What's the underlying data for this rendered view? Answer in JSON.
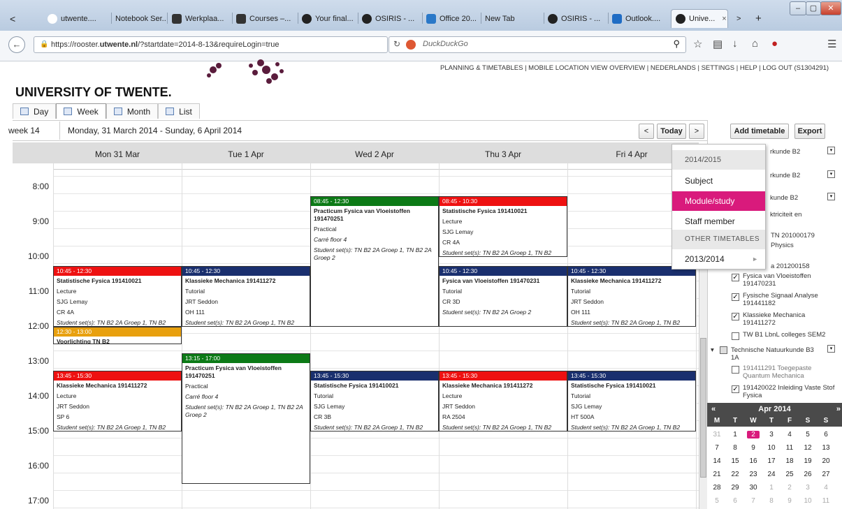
{
  "browser": {
    "tabs": [
      {
        "label": "",
        "icon": "back-arrow-icon"
      },
      {
        "label": "utwente....",
        "icon": "ut-icon",
        "color": "#ffffff"
      },
      {
        "label": "Notebook Ser...",
        "icon": "",
        "color": ""
      },
      {
        "label": "Werkplaa...",
        "icon": "blackboard-icon",
        "color": "#333333"
      },
      {
        "label": "Courses –...",
        "icon": "blackboard-icon",
        "color": "#333333"
      },
      {
        "label": "Your final...",
        "icon": "ut-icon",
        "color": "#222222"
      },
      {
        "label": "OSIRIS - ...",
        "icon": "ut-icon",
        "color": "#222222"
      },
      {
        "label": "Office 20...",
        "icon": "office-icon",
        "color": "#2a78c8"
      },
      {
        "label": "New Tab",
        "icon": "",
        "color": ""
      },
      {
        "label": "OSIRIS - ...",
        "icon": "ut-icon",
        "color": "#222222"
      },
      {
        "label": "Outlook....",
        "icon": "outlook-icon",
        "color": "#1f6cc4"
      },
      {
        "label": "Unive...",
        "icon": "ut-icon",
        "color": "#222222"
      }
    ],
    "url_prefix": "https://rooster.",
    "url_domain": "utwente.nl",
    "url_suffix": "/?startdate=2014-8-13&requireLogin=true",
    "search_placeholder": "DuckDuckGo",
    "tab_close": "×",
    "tab_add": "+"
  },
  "site": {
    "top_links": "PLANNING & TIMETABLES | MOBILE   LOCATION VIEW   OVERVIEW | NEDERLANDS | SETTINGS | HELP | LOG OUT (S1304291)",
    "university": "UNIVERSITY OF TWENTE.",
    "view_tabs": [
      "Day",
      "Week",
      "Month",
      "List"
    ]
  },
  "toolbar": {
    "week_label": "week 14",
    "date_range": "Monday, 31 March 2014 - Sunday, 6 April 2014",
    "prev": "<",
    "today": "Today",
    "next": ">",
    "add_timetable": "Add timetable",
    "export": "Export"
  },
  "days": [
    "Mon 31 Mar",
    "Tue 1 Apr",
    "Wed 2 Apr",
    "Thu 3 Apr",
    "Fri 4 Apr"
  ],
  "hours": [
    "8:00",
    "9:00",
    "10:00",
    "11:00",
    "12:00",
    "13:00",
    "14:00",
    "15:00",
    "16:00",
    "17:00"
  ],
  "colors": {
    "red": "#ee1111",
    "navy": "#1a2f6e",
    "green": "#0c7a16",
    "orange": "#e8a00e",
    "accent": "#d91a7c"
  },
  "events": [
    {
      "day": 2,
      "time": "08:45 - 12:30",
      "color": "#0c7a16",
      "title": "Practicum Fysica van Vloeistoffen 191470251",
      "lines": [
        "Practical",
        "Carré floor 4",
        "Student set(s): TN B2 2A Groep 1, TN B2 2A Groep 2"
      ]
    },
    {
      "day": 3,
      "time": "08:45 - 10:30",
      "color": "#ee1111",
      "title": "Statistische Fysica 191410021",
      "lines": [
        "Lecture",
        "SJG Lemay",
        "CR 4A",
        "Student set(s): TN B2 2A Groep 1, TN B2"
      ]
    },
    {
      "day": 0,
      "time": "10:45 - 12:30",
      "color": "#ee1111",
      "title": "Statistische Fysica 191410021",
      "lines": [
        "Lecture",
        "SJG Lemay",
        "CR 4A",
        "Student set(s): TN B2 2A Groep 1, TN B2"
      ]
    },
    {
      "day": 1,
      "time": "10:45 - 12:30",
      "color": "#1a2f6e",
      "title": "Klassieke Mechanica 191411272",
      "lines": [
        "Tutorial",
        "JRT Seddon",
        "OH 111",
        "Student set(s): TN B2 2A Groep 1, TN B2"
      ]
    },
    {
      "day": 3,
      "time": "10:45 - 12:30",
      "color": "#1a2f6e",
      "title": "Fysica van Vloeistoffen 191470231",
      "lines": [
        "Tutorial",
        "CR 3D",
        "Student set(s): TN B2 2A Groep 2"
      ]
    },
    {
      "day": 4,
      "time": "10:45 - 12:30",
      "color": "#1a2f6e",
      "title": "Klassieke Mechanica 191411272",
      "lines": [
        "Tutorial",
        "JRT Seddon",
        "OH 111",
        "Student set(s): TN B2 2A Groep 1, TN B2"
      ]
    },
    {
      "day": 0,
      "time": "12:30 - 13:00",
      "color": "#e8a00e",
      "title": "Voorlichting TN B2",
      "lines": []
    },
    {
      "day": 1,
      "time": "13:15 - 17:00",
      "color": "#0c7a16",
      "title": "Practicum Fysica van Vloeistoffen 191470251",
      "lines": [
        "Practical",
        "Carré floor 4",
        "Student set(s): TN B2 2A Groep 1, TN B2 2A Groep 2"
      ]
    },
    {
      "day": 0,
      "time": "13:45 - 15:30",
      "color": "#ee1111",
      "title": "Klassieke Mechanica 191411272",
      "lines": [
        "Lecture",
        "JRT Seddon",
        "SP 6",
        "Student set(s): TN B2 2A Groep 1, TN B2"
      ]
    },
    {
      "day": 2,
      "time": "13:45 - 15:30",
      "color": "#1a2f6e",
      "title": "Statistische Fysica 191410021",
      "lines": [
        "Tutorial",
        "SJG Lemay",
        "CR 3B",
        "Student set(s): TN B2 2A Groep 1, TN B2"
      ]
    },
    {
      "day": 3,
      "time": "13:45 - 15:30",
      "color": "#ee1111",
      "title": "Klassieke Mechanica 191411272",
      "lines": [
        "Lecture",
        "JRT Seddon",
        "RA 2504",
        "Student set(s): TN B2 2A Groep 1, TN B2"
      ]
    },
    {
      "day": 4,
      "time": "13:45 - 15:30",
      "color": "#1a2f6e",
      "title": "Statistische Fysica 191410021",
      "lines": [
        "Tutorial",
        "SJG Lemay",
        "HT 500A",
        "Student set(s): TN B2 2A Groep 1, TN B2"
      ]
    }
  ],
  "dropdown": {
    "header": "2014/2015",
    "items": [
      "Subject",
      "Module/study programme",
      "Staff member"
    ],
    "other_header": "OTHER TIMETABLES",
    "other_items": [
      "2013/2014"
    ]
  },
  "right_panel": {
    "items": [
      {
        "text": "rkunde B2",
        "checked": false
      },
      {
        "text": "rkunde B2",
        "checked": false
      },
      {
        "text": "kunde B2",
        "checked": false
      },
      {
        "text": "ktriciteit en",
        "checked": false
      },
      {
        "text": "TN 201000179",
        "checked": false
      },
      {
        "text": "Physics",
        "checked": false
      },
      {
        "text": "a 201200158",
        "checked": false
      }
    ],
    "subjects": [
      {
        "text": "Fysica van Vloeistoffen 191470231",
        "checked": true
      },
      {
        "text": "Fysische Signaal Analyse 191441182",
        "checked": true
      },
      {
        "text": "Klassieke Mechanica 191411272",
        "checked": true
      },
      {
        "text": "TW B1 LbnL colleges SEM2",
        "checked": false
      }
    ],
    "group2_title": "Technische Natuurkunde B3 1A",
    "group2_items": [
      {
        "text": "191411291 Toegepaste Quantum Mechanica",
        "checked": false
      },
      {
        "text": "191420022 Inleiding Vaste Stof Fysica",
        "checked": true
      }
    ]
  },
  "calendar": {
    "month": "Apr 2014",
    "prev": "«",
    "next": "»",
    "weekdays": [
      "M",
      "T",
      "W",
      "T",
      "F",
      "S",
      "S"
    ],
    "weeks": [
      [
        "31",
        "1",
        "2",
        "3",
        "4",
        "5",
        "6"
      ],
      [
        "7",
        "8",
        "9",
        "10",
        "11",
        "12",
        "13"
      ],
      [
        "14",
        "15",
        "16",
        "17",
        "18",
        "19",
        "20"
      ],
      [
        "21",
        "22",
        "23",
        "24",
        "25",
        "26",
        "27"
      ],
      [
        "28",
        "29",
        "30",
        "1",
        "2",
        "3",
        "4"
      ],
      [
        "5",
        "6",
        "7",
        "8",
        "9",
        "10",
        "11"
      ]
    ],
    "today": "2"
  }
}
